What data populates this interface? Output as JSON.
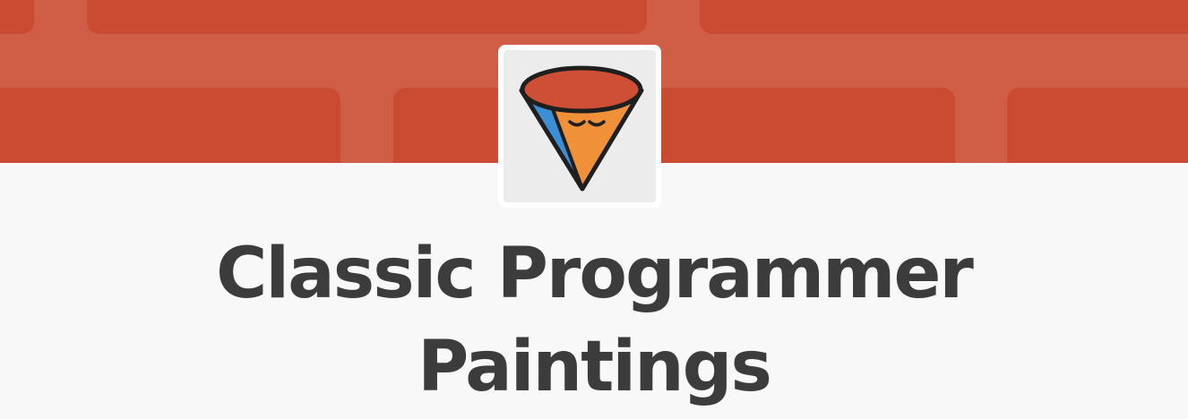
{
  "colors": {
    "banner_red": "#cb4a32",
    "banner_light_red": "#d05d46",
    "page_background": "#f8f8f8",
    "title_text": "#3c3c3c",
    "avatar_orange": "#f0913a",
    "avatar_blue": "#3b8fd6",
    "avatar_top_red": "#cf4f36"
  },
  "icons": {
    "avatar": "cone-face-avatar-icon"
  },
  "title": {
    "line1": "Classic Programmer",
    "line2": "Paintings"
  }
}
